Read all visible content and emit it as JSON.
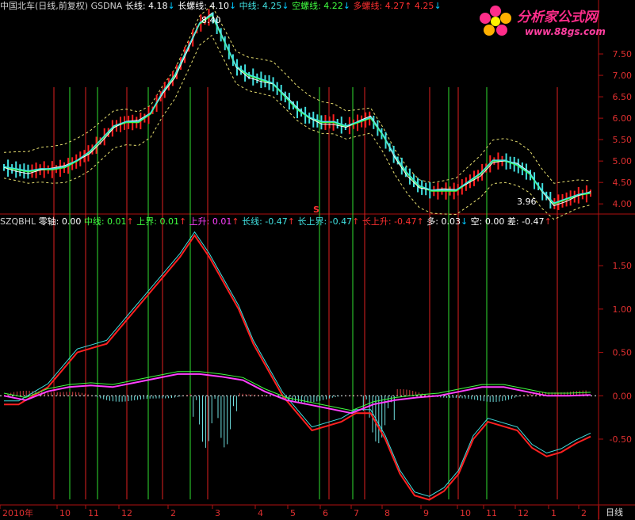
{
  "app": {
    "stock_title": "中国北车(日线,前复权)",
    "period_label": "日线"
  },
  "upper_legend": [
    {
      "text": "中国北车(日线,前复权)",
      "color": "#d0d0d0"
    },
    {
      "text": " GSDNA",
      "color": "#d0d0d0"
    },
    {
      "text": "  长线: 4.18",
      "color": "#ffffff"
    },
    {
      "text": "↓",
      "color": "#00c8ff"
    },
    {
      "text": "  长螺线: 4.10",
      "color": "#ffffff"
    },
    {
      "text": "↓",
      "color": "#00c8ff"
    },
    {
      "text": "  中线: 4.25",
      "color": "#40e0e0"
    },
    {
      "text": "↓",
      "color": "#00c8ff"
    },
    {
      "text": "  空螺线: 4.22",
      "color": "#40ff40"
    },
    {
      "text": "↓",
      "color": "#00c8ff"
    },
    {
      "text": "  多螺线: 4.27",
      "color": "#ff3030"
    },
    {
      "text": "↑",
      "color": "#ff3030"
    },
    {
      "text": "    4.25",
      "color": "#ff3030"
    },
    {
      "text": "↓",
      "color": "#00c8ff"
    }
  ],
  "lower_legend": [
    {
      "text": "SZQBHL",
      "color": "#d0d0d0"
    },
    {
      "text": "  零轴: 0.00",
      "color": "#ffffff"
    },
    {
      "text": "  中线: 0.01",
      "color": "#40ff40"
    },
    {
      "text": "↑",
      "color": "#ff3030"
    },
    {
      "text": "  上界: 0.01",
      "color": "#40ff40"
    },
    {
      "text": "↑",
      "color": "#ff3030"
    },
    {
      "text": "  上升: 0.01",
      "color": "#ff40ff"
    },
    {
      "text": "↑",
      "color": "#ff3030"
    },
    {
      "text": "  长线: -0.47",
      "color": "#40e0e0"
    },
    {
      "text": "↑",
      "color": "#ff3030"
    },
    {
      "text": "  长上界: -0.47",
      "color": "#40e0e0"
    },
    {
      "text": "↑",
      "color": "#ff3030"
    },
    {
      "text": "  长上升: -0.47",
      "color": "#ff3030"
    },
    {
      "text": "↑",
      "color": "#ff3030"
    },
    {
      "text": "  多: 0.03",
      "color": "#ffffff"
    },
    {
      "text": "↓",
      "color": "#00c8ff"
    },
    {
      "text": "  空: 0.00",
      "color": "#ffffff"
    },
    {
      "text": "  差: -0.47",
      "color": "#ffffff"
    },
    {
      "text": "↑",
      "color": "#ff3030"
    }
  ],
  "annotations": {
    "high": "8.40",
    "low": "3.96",
    "marker": "S"
  },
  "logo": {
    "title": "分析家公式网",
    "url": "www.88gs.com"
  },
  "upper_axis": [
    "7.50",
    "7.00",
    "6.50",
    "6.00",
    "5.50",
    "5.00",
    "4.50",
    "4.00"
  ],
  "lower_axis": [
    "1.50",
    "1.00",
    "0.50",
    "0.00",
    "-0.50"
  ],
  "x_labels": [
    "2010年",
    "10",
    "11",
    "12",
    "2",
    "3",
    "4",
    "5",
    "6",
    "7",
    "8",
    "9",
    "10",
    "11",
    "12",
    "1",
    "2"
  ],
  "colors": {
    "up": "#ff2020",
    "down": "#40e0e0",
    "green": "#40ff40",
    "magenta": "#ff40ff",
    "axis": "#b01010"
  },
  "chart_data": [
    {
      "type": "line",
      "title": "GSDNA",
      "ylim": [
        3.8,
        8.5
      ],
      "y_ticks": [
        7.5,
        7.0,
        6.5,
        6.0,
        5.5,
        5.0,
        4.5,
        4.0
      ],
      "series": [
        {
          "name": "长线",
          "last": 4.18
        },
        {
          "name": "长螺线",
          "last": 4.1
        },
        {
          "name": "中线",
          "last": 4.25
        },
        {
          "name": "空螺线",
          "last": 4.22
        },
        {
          "name": "多螺线",
          "last": 4.27
        }
      ],
      "price_path": [
        4.85,
        4.8,
        4.75,
        4.8,
        4.8,
        4.85,
        5.0,
        5.2,
        5.5,
        5.8,
        5.9,
        5.9,
        6.1,
        6.6,
        7.0,
        7.6,
        8.2,
        8.4,
        7.8,
        7.2,
        7.0,
        6.9,
        6.8,
        6.5,
        6.2,
        6.0,
        5.9,
        5.9,
        5.8,
        5.9,
        6.0,
        5.6,
        5.1,
        4.7,
        4.4,
        4.3,
        4.3,
        4.3,
        4.5,
        4.7,
        5.0,
        5.0,
        4.9,
        4.7,
        4.3,
        4.0,
        4.1,
        4.2,
        4.25
      ]
    },
    {
      "type": "line",
      "title": "SZQBHL",
      "ylim": [
        -1.25,
        1.95
      ],
      "y_ticks": [
        1.5,
        1.0,
        0.5,
        0.0,
        -0.5
      ],
      "series": [
        {
          "name": "零轴",
          "last": 0.0
        },
        {
          "name": "中线",
          "last": 0.01
        },
        {
          "name": "上界",
          "last": 0.01
        },
        {
          "name": "上升",
          "last": 0.01
        },
        {
          "name": "长线",
          "last": -0.47
        },
        {
          "name": "长上界",
          "last": -0.47
        },
        {
          "name": "长上升",
          "last": -0.47
        },
        {
          "name": "多",
          "last": 0.03
        },
        {
          "name": "空",
          "last": 0.0
        },
        {
          "name": "差",
          "last": -0.47
        }
      ],
      "long_path": [
        -0.1,
        -0.1,
        0.0,
        0.1,
        0.3,
        0.5,
        0.55,
        0.6,
        0.8,
        1.0,
        1.2,
        1.4,
        1.6,
        1.85,
        1.6,
        1.3,
        1.0,
        0.6,
        0.3,
        0.0,
        -0.2,
        -0.4,
        -0.35,
        -0.3,
        -0.2,
        -0.2,
        -0.5,
        -0.9,
        -1.15,
        -1.2,
        -1.1,
        -0.9,
        -0.5,
        -0.3,
        -0.35,
        -0.4,
        -0.6,
        -0.7,
        -0.65,
        -0.55,
        -0.47
      ],
      "mid_path": [
        0.0,
        -0.05,
        0.05,
        0.1,
        0.12,
        0.1,
        0.15,
        0.2,
        0.25,
        0.25,
        0.22,
        0.18,
        0.05,
        -0.05,
        -0.1,
        -0.15,
        -0.2,
        -0.1,
        -0.05,
        -0.02,
        0.0,
        0.05,
        0.1,
        0.1,
        0.05,
        0.0,
        0.0,
        0.01
      ]
    }
  ]
}
